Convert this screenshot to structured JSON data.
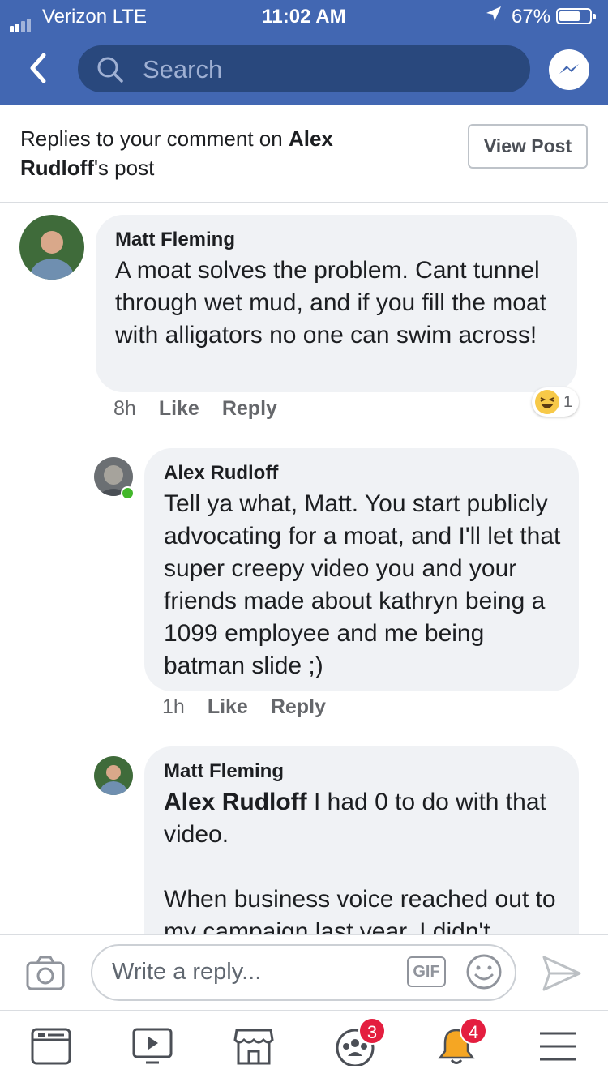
{
  "status_bar": {
    "carrier": "Verizon  LTE",
    "time": "11:02 AM",
    "battery": "67%",
    "battery_level": 0.67
  },
  "navbar": {
    "search_placeholder": "Search",
    "colors": {
      "nav": "#4267b2",
      "search": "#29487d"
    }
  },
  "header": {
    "prefix": "Replies to your comment on ",
    "post_owner": "Alex Rudloff",
    "suffix": "'s post",
    "view_post_label": "View Post"
  },
  "comments": [
    {
      "author": "Matt Fleming",
      "text": "A moat solves the problem. Cant tunnel through wet mud, and if you fill the moat with alligators no one can swim across!",
      "time": "8h",
      "like": "Like",
      "reply": "Reply",
      "reaction": {
        "icon": "haha-emoji-icon",
        "count": "1"
      }
    },
    {
      "author": "Alex Rudloff",
      "text": "Tell ya what, Matt. You start publicly advocating for a moat, and I'll let that super creepy video you and your friends made about kathryn being a 1099 employee and me being batman slide ;)",
      "time": "1h",
      "like": "Like",
      "reply": "Reply"
    },
    {
      "author": "Matt Fleming",
      "mention": "Alex Rudloff",
      "text": " I had 0 to do with that video.",
      "text2": "When business voice reached out to my campaign last year, I didn't"
    }
  ],
  "composer": {
    "placeholder": "Write a reply...",
    "gif_label": "GIF"
  },
  "tabbar": {
    "items": [
      "news-feed-icon",
      "watch-icon",
      "marketplace-icon",
      "groups-icon",
      "notifications-icon",
      "menu-icon"
    ],
    "groups_badge": "3",
    "notifications_badge": "4"
  }
}
